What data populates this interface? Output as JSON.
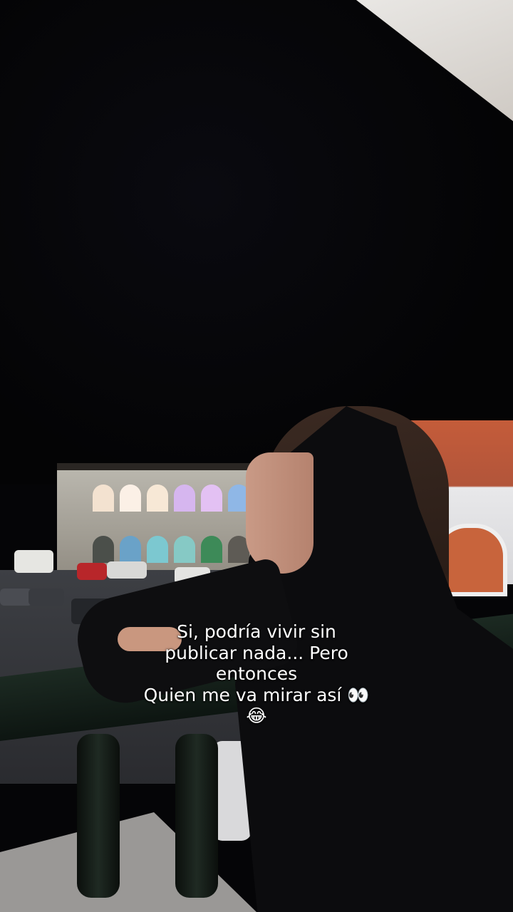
{
  "caption": {
    "lines": [
      "Si, podría vivir sin",
      "publicar nada... Pero",
      "entonces",
      "Quien me va mirar así 👀",
      "😂"
    ]
  },
  "colors": {
    "caption_text": "#ffffff",
    "night_sky": "#050507",
    "accent_building": "#c45c3a"
  }
}
